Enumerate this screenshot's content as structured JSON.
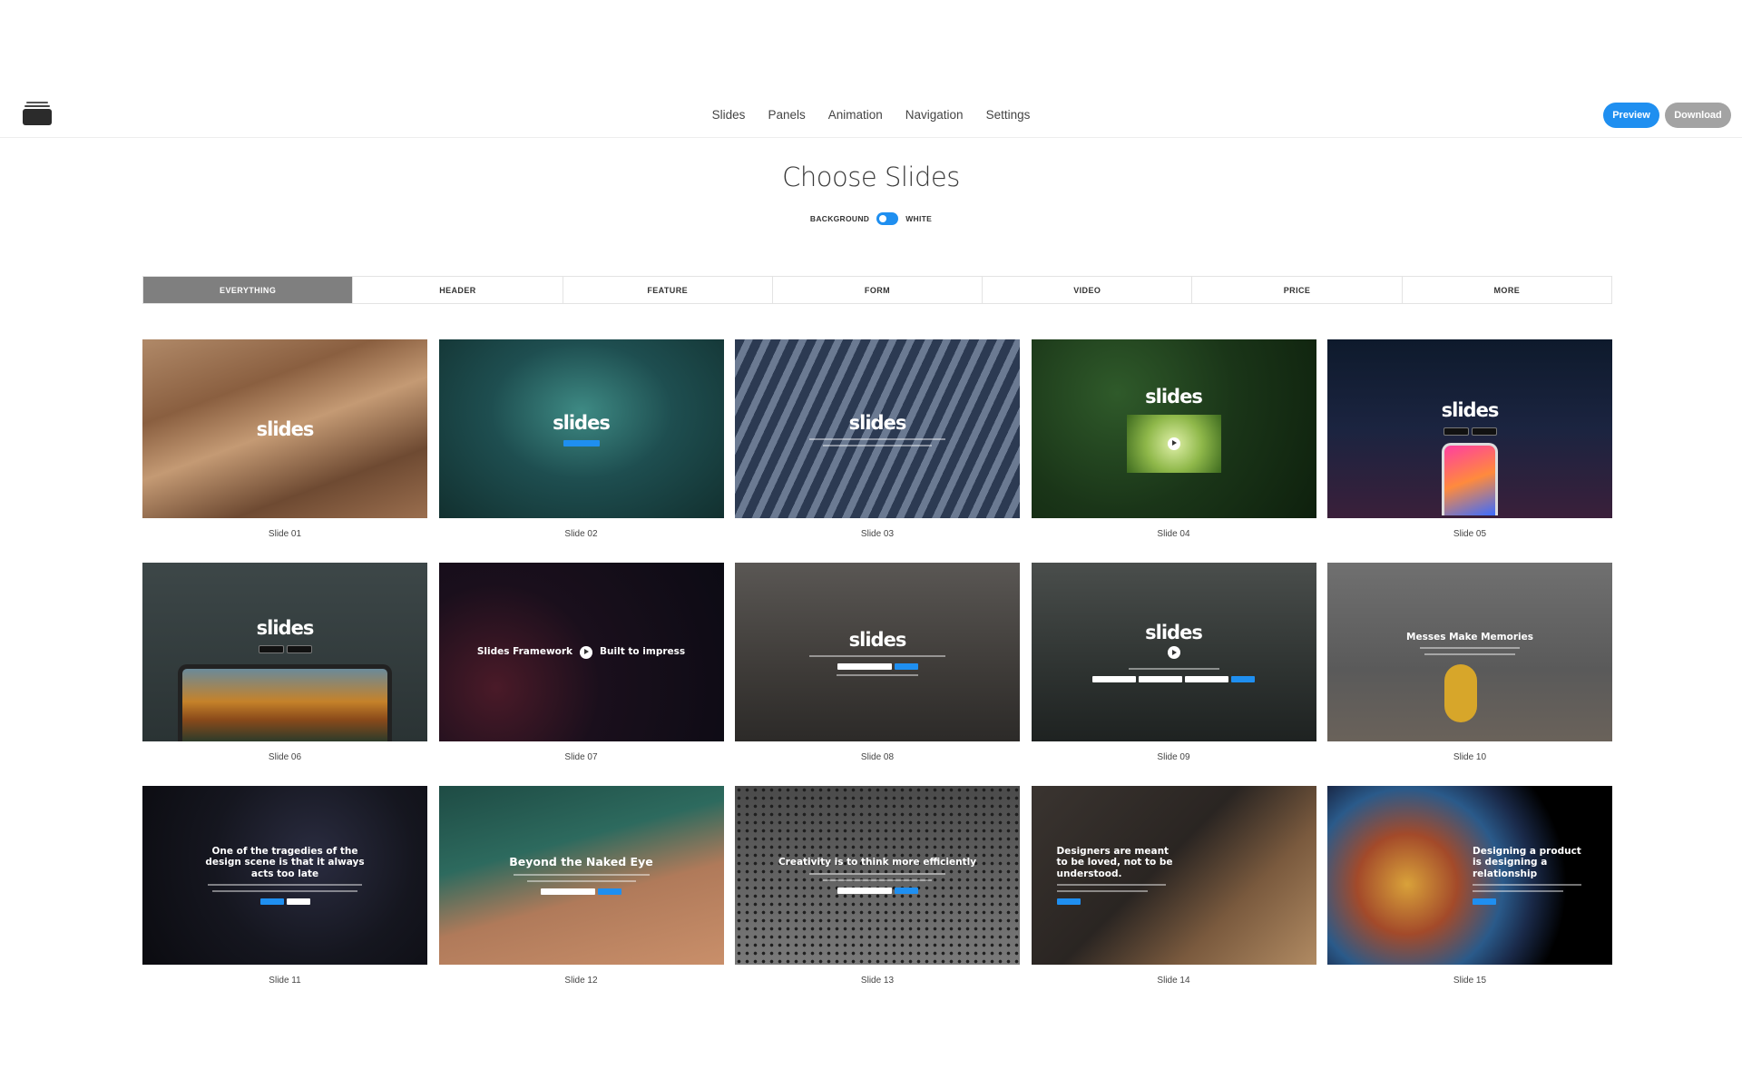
{
  "nav": {
    "items": [
      "Slides",
      "Panels",
      "Animation",
      "Navigation",
      "Settings"
    ],
    "preview_label": "Preview",
    "download_label": "Download"
  },
  "heading": {
    "title": "Choose Slides",
    "toggle_left": "BACKGROUND",
    "toggle_right": "WHITE"
  },
  "tabs": [
    "EVERYTHING",
    "HEADER",
    "FEATURE",
    "FORM",
    "VIDEO",
    "PRICE",
    "MORE"
  ],
  "active_tab": "EVERYTHING",
  "slides": [
    {
      "caption": "Slide 01",
      "text": "slides"
    },
    {
      "caption": "Slide 02",
      "text": "slides"
    },
    {
      "caption": "Slide 03",
      "text": "slides"
    },
    {
      "caption": "Slide 04",
      "text": "slides"
    },
    {
      "caption": "Slide 05",
      "text": "slides"
    },
    {
      "caption": "Slide 06",
      "text": "slides"
    },
    {
      "caption": "Slide 07",
      "text": "Slides Framework",
      "text2": "Built to impress"
    },
    {
      "caption": "Slide 08",
      "text": "slides"
    },
    {
      "caption": "Slide 09",
      "text": "slides"
    },
    {
      "caption": "Slide 10",
      "text": "Messes Make Memories"
    },
    {
      "caption": "Slide 11",
      "text": "One of the tragedies of the design scene is that it always acts too late"
    },
    {
      "caption": "Slide 12",
      "text": "Beyond the Naked Eye"
    },
    {
      "caption": "Slide 13",
      "text": "Creativity is to think more efficiently"
    },
    {
      "caption": "Slide 14",
      "text": "Designers are meant to be loved, not to be understood."
    },
    {
      "caption": "Slide 15",
      "text": "Designing a product is designing a relationship"
    }
  ],
  "colors": {
    "accent": "#1f8ff0",
    "download": "#a3a3a3",
    "active_tab": "#7f7f7f"
  }
}
